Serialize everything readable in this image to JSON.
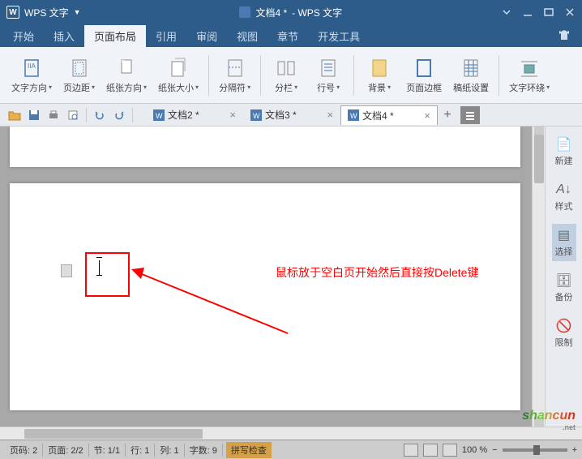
{
  "title": {
    "app": "WPS 文字",
    "doc": "文档4 *",
    "suffix": "- WPS 文字"
  },
  "menus": [
    "开始",
    "插入",
    "页面布局",
    "引用",
    "审阅",
    "视图",
    "章节",
    "开发工具"
  ],
  "active_menu": 2,
  "ribbon": [
    {
      "label": "文字方向",
      "icon": "text-direction",
      "dd": true
    },
    {
      "label": "页边距",
      "icon": "margins",
      "dd": true
    },
    {
      "label": "纸张方向",
      "icon": "orientation",
      "dd": true
    },
    {
      "label": "纸张大小",
      "icon": "size",
      "dd": true
    },
    {
      "label": "分隔符",
      "icon": "breaks",
      "dd": true
    },
    {
      "label": "分栏",
      "icon": "columns",
      "dd": true
    },
    {
      "label": "行号",
      "icon": "line-numbers",
      "dd": true
    },
    {
      "label": "背景",
      "icon": "background",
      "dd": true
    },
    {
      "label": "页面边框",
      "icon": "page-borders",
      "dd": false
    },
    {
      "label": "稿纸设置",
      "icon": "manuscript",
      "dd": false
    },
    {
      "label": "文字环绕",
      "icon": "text-wrap",
      "dd": true
    }
  ],
  "tabs": [
    {
      "label": "文档2 *",
      "active": false
    },
    {
      "label": "文档3 *",
      "active": false
    },
    {
      "label": "文档4 *",
      "active": true
    }
  ],
  "sidepanel": [
    {
      "label": "新建",
      "icon": "new"
    },
    {
      "label": "样式",
      "icon": "style"
    },
    {
      "label": "选择",
      "icon": "select"
    },
    {
      "label": "备份",
      "icon": "backup"
    },
    {
      "label": "限制",
      "icon": "restrict"
    }
  ],
  "sidepanel_active": 2,
  "annotation": "鼠标放于空白页开始然后直接按Delete键",
  "status": {
    "page_no_label": "页码:",
    "page_no": "2",
    "page_label": "页面:",
    "page": "2/2",
    "section_label": "节:",
    "section": "1/1",
    "row_label": "行:",
    "row": "1",
    "col_label": "列:",
    "col": "1",
    "wc_label": "字数:",
    "wc": "9",
    "spell": "拼写检查",
    "zoom": "100 %"
  },
  "watermark": "shancun",
  "watermark_sub": ".net"
}
